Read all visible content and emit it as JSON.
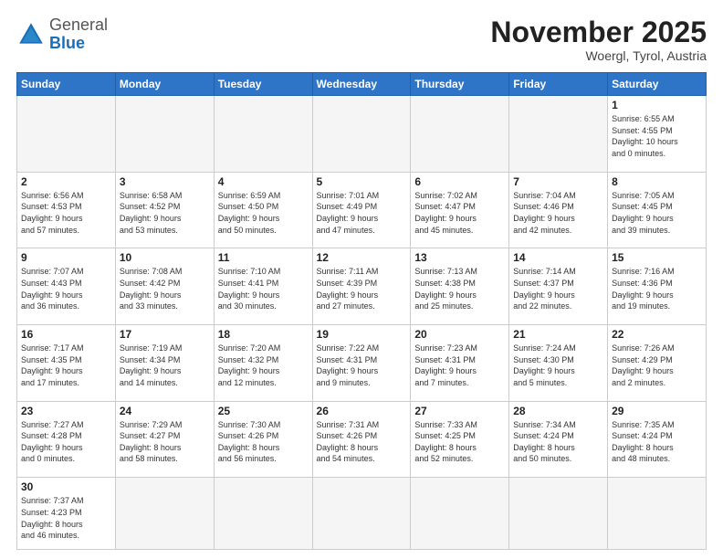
{
  "header": {
    "logo_general": "General",
    "logo_blue": "Blue",
    "month_title": "November 2025",
    "subtitle": "Woergl, Tyrol, Austria"
  },
  "weekdays": [
    "Sunday",
    "Monday",
    "Tuesday",
    "Wednesday",
    "Thursday",
    "Friday",
    "Saturday"
  ],
  "weeks": [
    [
      {
        "day": "",
        "info": "",
        "empty": true
      },
      {
        "day": "",
        "info": "",
        "empty": true
      },
      {
        "day": "",
        "info": "",
        "empty": true
      },
      {
        "day": "",
        "info": "",
        "empty": true
      },
      {
        "day": "",
        "info": "",
        "empty": true
      },
      {
        "day": "",
        "info": "",
        "empty": true
      },
      {
        "day": "1",
        "info": "Sunrise: 6:55 AM\nSunset: 4:55 PM\nDaylight: 10 hours\nand 0 minutes.",
        "empty": false
      }
    ],
    [
      {
        "day": "2",
        "info": "Sunrise: 6:56 AM\nSunset: 4:53 PM\nDaylight: 9 hours\nand 57 minutes.",
        "empty": false
      },
      {
        "day": "3",
        "info": "Sunrise: 6:58 AM\nSunset: 4:52 PM\nDaylight: 9 hours\nand 53 minutes.",
        "empty": false
      },
      {
        "day": "4",
        "info": "Sunrise: 6:59 AM\nSunset: 4:50 PM\nDaylight: 9 hours\nand 50 minutes.",
        "empty": false
      },
      {
        "day": "5",
        "info": "Sunrise: 7:01 AM\nSunset: 4:49 PM\nDaylight: 9 hours\nand 47 minutes.",
        "empty": false
      },
      {
        "day": "6",
        "info": "Sunrise: 7:02 AM\nSunset: 4:47 PM\nDaylight: 9 hours\nand 45 minutes.",
        "empty": false
      },
      {
        "day": "7",
        "info": "Sunrise: 7:04 AM\nSunset: 4:46 PM\nDaylight: 9 hours\nand 42 minutes.",
        "empty": false
      },
      {
        "day": "8",
        "info": "Sunrise: 7:05 AM\nSunset: 4:45 PM\nDaylight: 9 hours\nand 39 minutes.",
        "empty": false
      }
    ],
    [
      {
        "day": "9",
        "info": "Sunrise: 7:07 AM\nSunset: 4:43 PM\nDaylight: 9 hours\nand 36 minutes.",
        "empty": false
      },
      {
        "day": "10",
        "info": "Sunrise: 7:08 AM\nSunset: 4:42 PM\nDaylight: 9 hours\nand 33 minutes.",
        "empty": false
      },
      {
        "day": "11",
        "info": "Sunrise: 7:10 AM\nSunset: 4:41 PM\nDaylight: 9 hours\nand 30 minutes.",
        "empty": false
      },
      {
        "day": "12",
        "info": "Sunrise: 7:11 AM\nSunset: 4:39 PM\nDaylight: 9 hours\nand 27 minutes.",
        "empty": false
      },
      {
        "day": "13",
        "info": "Sunrise: 7:13 AM\nSunset: 4:38 PM\nDaylight: 9 hours\nand 25 minutes.",
        "empty": false
      },
      {
        "day": "14",
        "info": "Sunrise: 7:14 AM\nSunset: 4:37 PM\nDaylight: 9 hours\nand 22 minutes.",
        "empty": false
      },
      {
        "day": "15",
        "info": "Sunrise: 7:16 AM\nSunset: 4:36 PM\nDaylight: 9 hours\nand 19 minutes.",
        "empty": false
      }
    ],
    [
      {
        "day": "16",
        "info": "Sunrise: 7:17 AM\nSunset: 4:35 PM\nDaylight: 9 hours\nand 17 minutes.",
        "empty": false
      },
      {
        "day": "17",
        "info": "Sunrise: 7:19 AM\nSunset: 4:34 PM\nDaylight: 9 hours\nand 14 minutes.",
        "empty": false
      },
      {
        "day": "18",
        "info": "Sunrise: 7:20 AM\nSunset: 4:32 PM\nDaylight: 9 hours\nand 12 minutes.",
        "empty": false
      },
      {
        "day": "19",
        "info": "Sunrise: 7:22 AM\nSunset: 4:31 PM\nDaylight: 9 hours\nand 9 minutes.",
        "empty": false
      },
      {
        "day": "20",
        "info": "Sunrise: 7:23 AM\nSunset: 4:31 PM\nDaylight: 9 hours\nand 7 minutes.",
        "empty": false
      },
      {
        "day": "21",
        "info": "Sunrise: 7:24 AM\nSunset: 4:30 PM\nDaylight: 9 hours\nand 5 minutes.",
        "empty": false
      },
      {
        "day": "22",
        "info": "Sunrise: 7:26 AM\nSunset: 4:29 PM\nDaylight: 9 hours\nand 2 minutes.",
        "empty": false
      }
    ],
    [
      {
        "day": "23",
        "info": "Sunrise: 7:27 AM\nSunset: 4:28 PM\nDaylight: 9 hours\nand 0 minutes.",
        "empty": false
      },
      {
        "day": "24",
        "info": "Sunrise: 7:29 AM\nSunset: 4:27 PM\nDaylight: 8 hours\nand 58 minutes.",
        "empty": false
      },
      {
        "day": "25",
        "info": "Sunrise: 7:30 AM\nSunset: 4:26 PM\nDaylight: 8 hours\nand 56 minutes.",
        "empty": false
      },
      {
        "day": "26",
        "info": "Sunrise: 7:31 AM\nSunset: 4:26 PM\nDaylight: 8 hours\nand 54 minutes.",
        "empty": false
      },
      {
        "day": "27",
        "info": "Sunrise: 7:33 AM\nSunset: 4:25 PM\nDaylight: 8 hours\nand 52 minutes.",
        "empty": false
      },
      {
        "day": "28",
        "info": "Sunrise: 7:34 AM\nSunset: 4:24 PM\nDaylight: 8 hours\nand 50 minutes.",
        "empty": false
      },
      {
        "day": "29",
        "info": "Sunrise: 7:35 AM\nSunset: 4:24 PM\nDaylight: 8 hours\nand 48 minutes.",
        "empty": false
      }
    ],
    [
      {
        "day": "30",
        "info": "Sunrise: 7:37 AM\nSunset: 4:23 PM\nDaylight: 8 hours\nand 46 minutes.",
        "empty": false
      },
      {
        "day": "",
        "info": "",
        "empty": true
      },
      {
        "day": "",
        "info": "",
        "empty": true
      },
      {
        "day": "",
        "info": "",
        "empty": true
      },
      {
        "day": "",
        "info": "",
        "empty": true
      },
      {
        "day": "",
        "info": "",
        "empty": true
      },
      {
        "day": "",
        "info": "",
        "empty": true
      }
    ]
  ]
}
